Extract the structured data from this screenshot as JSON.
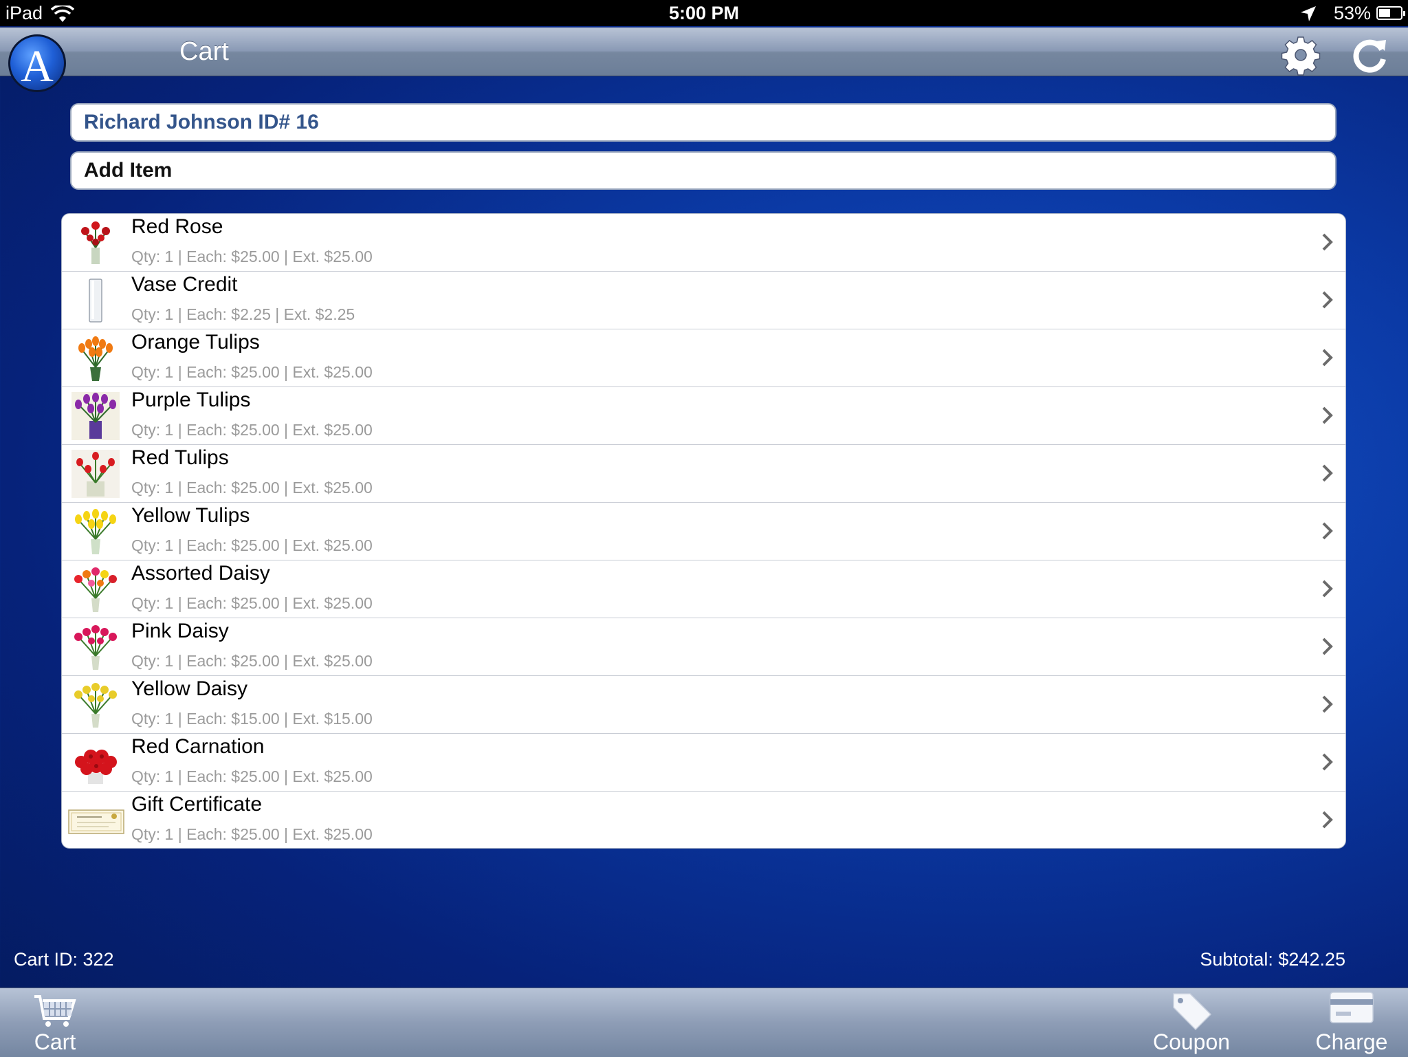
{
  "status_bar": {
    "carrier": "iPad",
    "time": "5:00 PM",
    "battery_percent": "53%",
    "battery_level": 0.53
  },
  "nav": {
    "logo_letter": "A",
    "title": "Cart",
    "settings_icon": "gear-icon",
    "refresh_icon": "refresh-icon"
  },
  "customer_field": {
    "value": "Richard Johnson ID# 16"
  },
  "add_item_field": {
    "value": "Add Item"
  },
  "cart": {
    "items": [
      {
        "name": "Red Rose",
        "detail": "Qty: 1 | Each: $25.00 | Ext.  $25.00",
        "thumb": "red-rose-icon"
      },
      {
        "name": "Vase Credit",
        "detail": "Qty: 1 | Each: $2.25 | Ext.  $2.25",
        "thumb": "vase-icon"
      },
      {
        "name": "Orange Tulips",
        "detail": "Qty: 1 | Each: $25.00 | Ext.  $25.00",
        "thumb": "orange-tulips-icon"
      },
      {
        "name": "Purple Tulips",
        "detail": "Qty: 1 | Each: $25.00 | Ext.  $25.00",
        "thumb": "purple-tulips-icon"
      },
      {
        "name": "Red Tulips",
        "detail": "Qty: 1 | Each: $25.00 | Ext.  $25.00",
        "thumb": "red-tulips-icon"
      },
      {
        "name": "Yellow Tulips",
        "detail": "Qty: 1 | Each: $25.00 | Ext.  $25.00",
        "thumb": "yellow-tulips-icon"
      },
      {
        "name": "Assorted Daisy",
        "detail": "Qty: 1 | Each: $25.00 | Ext.  $25.00",
        "thumb": "assorted-daisy-icon"
      },
      {
        "name": "Pink Daisy",
        "detail": "Qty: 1 | Each: $25.00 | Ext.  $25.00",
        "thumb": "pink-daisy-icon"
      },
      {
        "name": "Yellow Daisy",
        "detail": "Qty: 1 | Each: $15.00 | Ext.  $15.00",
        "thumb": "yellow-daisy-icon"
      },
      {
        "name": "Red Carnation",
        "detail": "Qty: 1 | Each: $25.00 | Ext.  $25.00",
        "thumb": "red-carnation-icon"
      },
      {
        "name": "Gift Certificate",
        "detail": "Qty: 1 | Each: $25.00 | Ext.  $25.00",
        "thumb": "gift-certificate-icon"
      }
    ]
  },
  "footer": {
    "cart_id": "Cart ID: 322",
    "subtotal": "Subtotal:  $242.25"
  },
  "tabs": {
    "cart": "Cart",
    "coupon": "Coupon",
    "charge": "Charge"
  },
  "colors": {
    "background": "#0b3aa6",
    "nav_bar": "#8a9ab5",
    "customer_text": "#34558b",
    "detail_text": "#9b9b9b"
  }
}
